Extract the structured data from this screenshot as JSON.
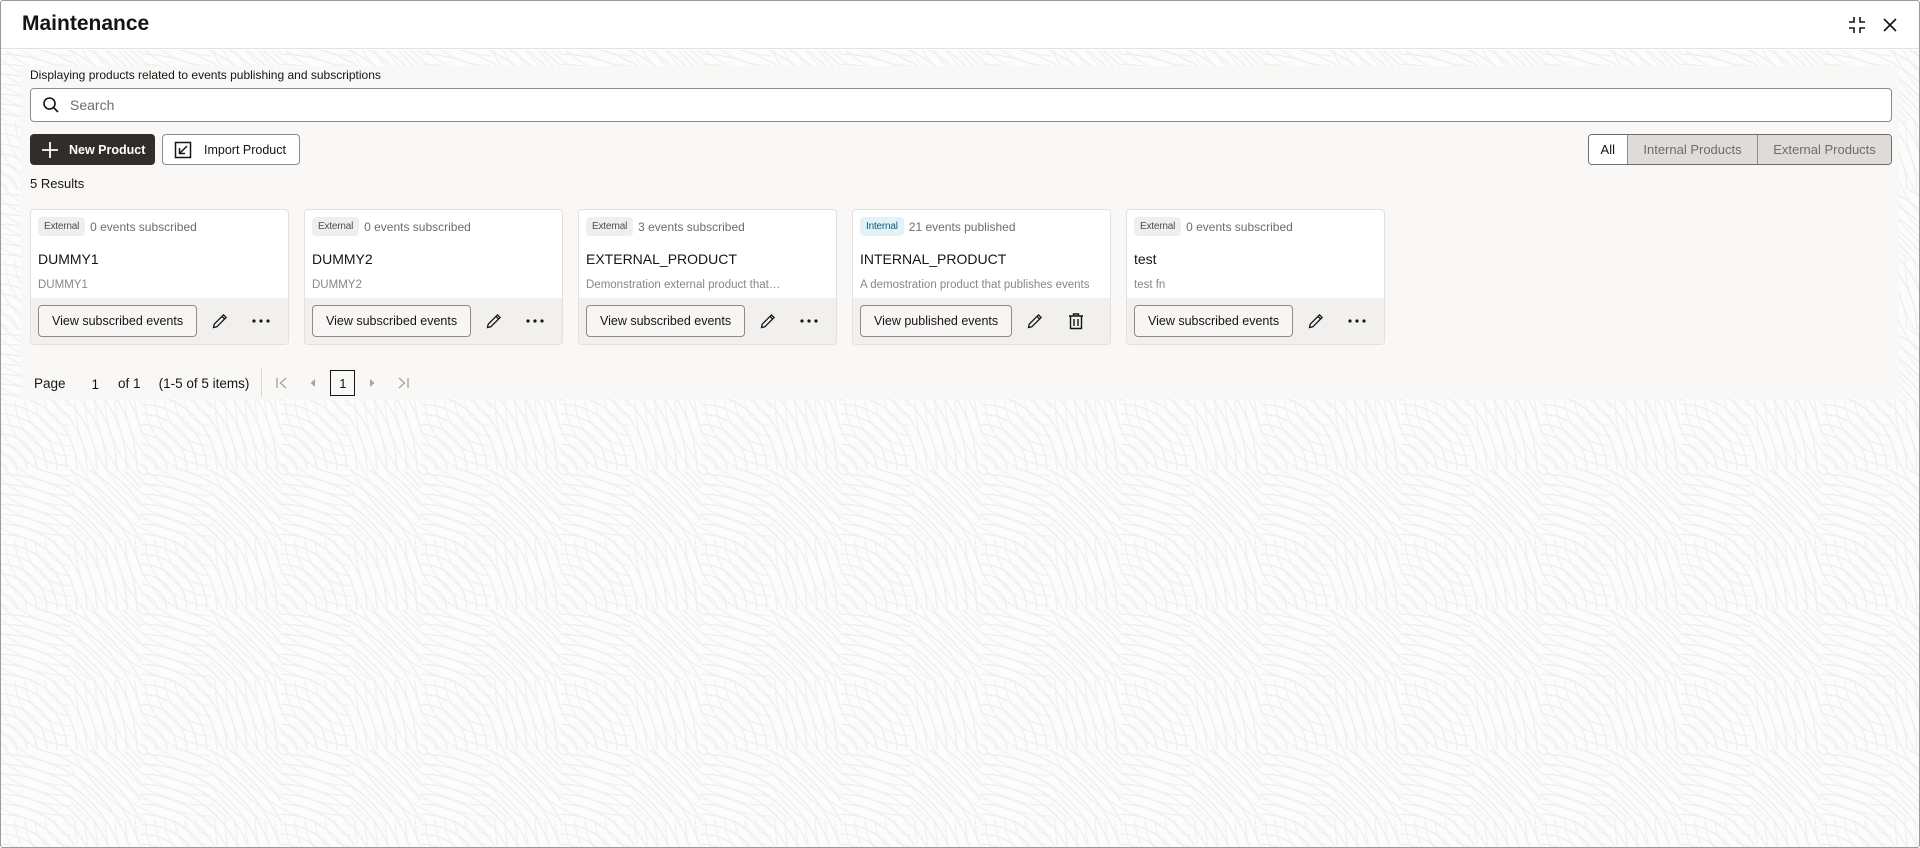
{
  "window": {
    "title": "Maintenance",
    "collapse_icon": "collapse-icon",
    "close_icon": "close-icon"
  },
  "panel": {
    "subtitle": "Displaying products related to events publishing and subscriptions",
    "search": {
      "placeholder": "Search",
      "value": "",
      "icon": "search-icon"
    },
    "toolbar": {
      "new_product_label": "New Product",
      "new_product_icon": "plus-icon",
      "import_product_label": "Import Product",
      "import_product_icon": "import-icon"
    },
    "filter": {
      "options": [
        "All",
        "Internal Products",
        "External Products"
      ],
      "selected": "All"
    },
    "results_label": "5 Results",
    "cards": [
      {
        "badge": "External",
        "count": "0 events subscribed",
        "name": "DUMMY1",
        "description": "DUMMY1",
        "action_label": "View subscribed events",
        "secondary_action": "more"
      },
      {
        "badge": "External",
        "count": "0 events subscribed",
        "name": "DUMMY2",
        "description": "DUMMY2",
        "action_label": "View subscribed events",
        "secondary_action": "more"
      },
      {
        "badge": "External",
        "count": "3 events subscribed",
        "name": "EXTERNAL_PRODUCT",
        "description": "Demonstration external product that…",
        "action_label": "View subscribed events",
        "secondary_action": "more"
      },
      {
        "badge": "Internal",
        "count": "21 events published",
        "name": "INTERNAL_PRODUCT",
        "description": "A demostration product that publishes events",
        "action_label": "View published events",
        "secondary_action": "delete"
      },
      {
        "badge": "External",
        "count": "0 events subscribed",
        "name": "test",
        "description": "test fn",
        "action_label": "View subscribed events",
        "secondary_action": "more"
      }
    ],
    "pagination": {
      "page_label": "Page",
      "page_value": "1",
      "of_label": "of 1",
      "range_label": "(1-5 of 5 items)",
      "current_page": "1"
    }
  },
  "colors": {
    "primary_button": "#312d2a",
    "internal_badge_bg": "#e4f1f7",
    "internal_badge_text": "#0c5f82",
    "external_badge_bg": "#f1efed"
  }
}
